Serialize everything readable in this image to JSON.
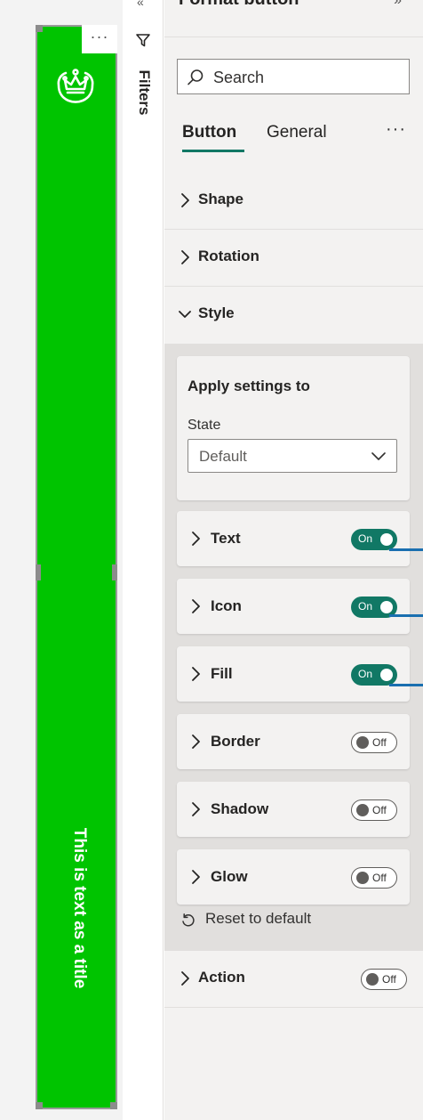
{
  "canvas": {
    "visual": {
      "more_label": "···",
      "logo_icon": "crown-logo-icon",
      "title_text": "This is text as a title",
      "fill_color": "#00c400"
    }
  },
  "filters": {
    "label": "Filters",
    "icon": "funnel-icon"
  },
  "pane": {
    "header_title": "Format button",
    "search": {
      "placeholder": "Search",
      "icon": "search-icon"
    },
    "tabs": [
      {
        "label": "Button",
        "selected": true
      },
      {
        "label": "General",
        "selected": false
      }
    ],
    "more_label": "···",
    "sections": {
      "shape": "Shape",
      "rotation": "Rotation",
      "style": "Style",
      "action": "Action"
    },
    "style": {
      "apply_settings_title": "Apply settings to",
      "state_label": "State",
      "state_value": "Default",
      "cards": [
        {
          "label": "Text",
          "toggle": "On"
        },
        {
          "label": "Icon",
          "toggle": "On"
        },
        {
          "label": "Fill",
          "toggle": "On"
        },
        {
          "label": "Border",
          "toggle": "Off"
        },
        {
          "label": "Shadow",
          "toggle": "Off"
        },
        {
          "label": "Glow",
          "toggle": "Off"
        }
      ],
      "reset_label": "Reset to default"
    },
    "action_toggle": "Off",
    "accent_color": "#117865"
  }
}
